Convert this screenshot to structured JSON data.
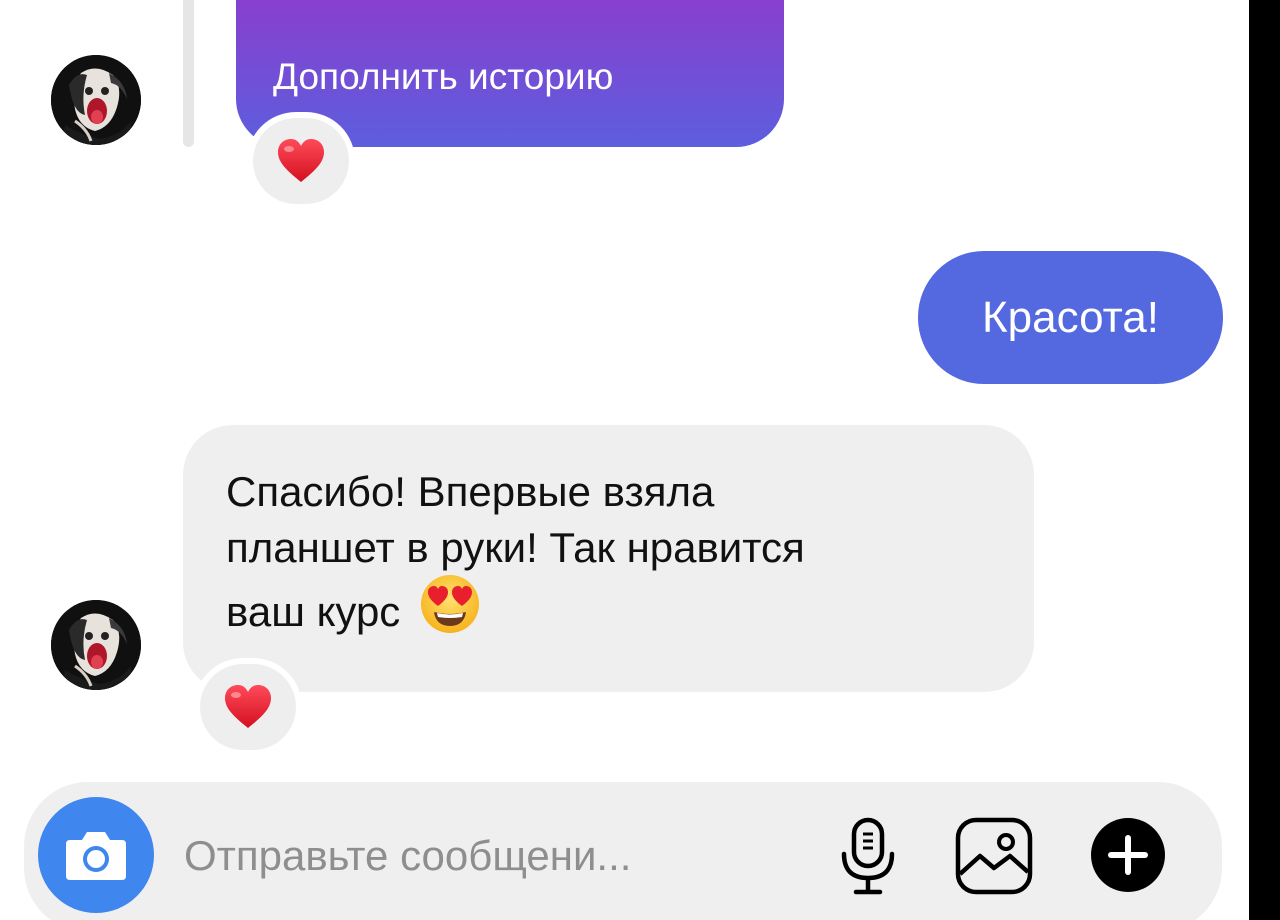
{
  "thread": {
    "story_reply_button_label": "Дополнить историю",
    "story_reaction_emoji": "red-heart",
    "outgoing_message": "Красота!",
    "incoming_message": {
      "lines": [
        "Спасибо! Впервые взяла",
        "планшет в руки! Так нравится",
        "ваш курс"
      ],
      "trailing_emoji": "smiling-face-with-heart-eyes"
    },
    "incoming_reaction_emoji": "red-heart"
  },
  "composer": {
    "placeholder": "Отправьте сообщени...",
    "icons": [
      "camera-icon",
      "microphone-icon",
      "gallery-icon",
      "plus-icon"
    ]
  },
  "colors": {
    "story_gradient_top": "#8e3bcc",
    "story_gradient_bottom": "#5d5ede",
    "outgoing_bubble": "#5468e0",
    "incoming_bubble": "#efefef",
    "composer_background": "#efefef",
    "camera_button": "#3f86ef"
  }
}
